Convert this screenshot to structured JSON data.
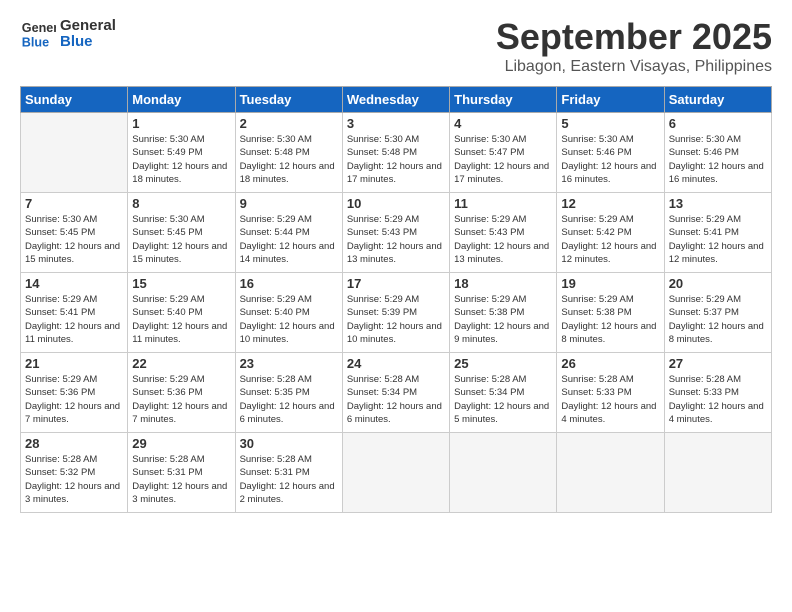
{
  "logo": {
    "line1": "General",
    "line2": "Blue"
  },
  "header": {
    "month": "September 2025",
    "location": "Libagon, Eastern Visayas, Philippines"
  },
  "days_of_week": [
    "Sunday",
    "Monday",
    "Tuesday",
    "Wednesday",
    "Thursday",
    "Friday",
    "Saturday"
  ],
  "weeks": [
    [
      {
        "day": "",
        "sunrise": "",
        "sunset": "",
        "daylight": "",
        "empty": true
      },
      {
        "day": "1",
        "sunrise": "Sunrise: 5:30 AM",
        "sunset": "Sunset: 5:49 PM",
        "daylight": "Daylight: 12 hours and 18 minutes."
      },
      {
        "day": "2",
        "sunrise": "Sunrise: 5:30 AM",
        "sunset": "Sunset: 5:48 PM",
        "daylight": "Daylight: 12 hours and 18 minutes."
      },
      {
        "day": "3",
        "sunrise": "Sunrise: 5:30 AM",
        "sunset": "Sunset: 5:48 PM",
        "daylight": "Daylight: 12 hours and 17 minutes."
      },
      {
        "day": "4",
        "sunrise": "Sunrise: 5:30 AM",
        "sunset": "Sunset: 5:47 PM",
        "daylight": "Daylight: 12 hours and 17 minutes."
      },
      {
        "day": "5",
        "sunrise": "Sunrise: 5:30 AM",
        "sunset": "Sunset: 5:46 PM",
        "daylight": "Daylight: 12 hours and 16 minutes."
      },
      {
        "day": "6",
        "sunrise": "Sunrise: 5:30 AM",
        "sunset": "Sunset: 5:46 PM",
        "daylight": "Daylight: 12 hours and 16 minutes."
      }
    ],
    [
      {
        "day": "7",
        "sunrise": "Sunrise: 5:30 AM",
        "sunset": "Sunset: 5:45 PM",
        "daylight": "Daylight: 12 hours and 15 minutes."
      },
      {
        "day": "8",
        "sunrise": "Sunrise: 5:30 AM",
        "sunset": "Sunset: 5:45 PM",
        "daylight": "Daylight: 12 hours and 15 minutes."
      },
      {
        "day": "9",
        "sunrise": "Sunrise: 5:29 AM",
        "sunset": "Sunset: 5:44 PM",
        "daylight": "Daylight: 12 hours and 14 minutes."
      },
      {
        "day": "10",
        "sunrise": "Sunrise: 5:29 AM",
        "sunset": "Sunset: 5:43 PM",
        "daylight": "Daylight: 12 hours and 13 minutes."
      },
      {
        "day": "11",
        "sunrise": "Sunrise: 5:29 AM",
        "sunset": "Sunset: 5:43 PM",
        "daylight": "Daylight: 12 hours and 13 minutes."
      },
      {
        "day": "12",
        "sunrise": "Sunrise: 5:29 AM",
        "sunset": "Sunset: 5:42 PM",
        "daylight": "Daylight: 12 hours and 12 minutes."
      },
      {
        "day": "13",
        "sunrise": "Sunrise: 5:29 AM",
        "sunset": "Sunset: 5:41 PM",
        "daylight": "Daylight: 12 hours and 12 minutes."
      }
    ],
    [
      {
        "day": "14",
        "sunrise": "Sunrise: 5:29 AM",
        "sunset": "Sunset: 5:41 PM",
        "daylight": "Daylight: 12 hours and 11 minutes."
      },
      {
        "day": "15",
        "sunrise": "Sunrise: 5:29 AM",
        "sunset": "Sunset: 5:40 PM",
        "daylight": "Daylight: 12 hours and 11 minutes."
      },
      {
        "day": "16",
        "sunrise": "Sunrise: 5:29 AM",
        "sunset": "Sunset: 5:40 PM",
        "daylight": "Daylight: 12 hours and 10 minutes."
      },
      {
        "day": "17",
        "sunrise": "Sunrise: 5:29 AM",
        "sunset": "Sunset: 5:39 PM",
        "daylight": "Daylight: 12 hours and 10 minutes."
      },
      {
        "day": "18",
        "sunrise": "Sunrise: 5:29 AM",
        "sunset": "Sunset: 5:38 PM",
        "daylight": "Daylight: 12 hours and 9 minutes."
      },
      {
        "day": "19",
        "sunrise": "Sunrise: 5:29 AM",
        "sunset": "Sunset: 5:38 PM",
        "daylight": "Daylight: 12 hours and 8 minutes."
      },
      {
        "day": "20",
        "sunrise": "Sunrise: 5:29 AM",
        "sunset": "Sunset: 5:37 PM",
        "daylight": "Daylight: 12 hours and 8 minutes."
      }
    ],
    [
      {
        "day": "21",
        "sunrise": "Sunrise: 5:29 AM",
        "sunset": "Sunset: 5:36 PM",
        "daylight": "Daylight: 12 hours and 7 minutes."
      },
      {
        "day": "22",
        "sunrise": "Sunrise: 5:29 AM",
        "sunset": "Sunset: 5:36 PM",
        "daylight": "Daylight: 12 hours and 7 minutes."
      },
      {
        "day": "23",
        "sunrise": "Sunrise: 5:28 AM",
        "sunset": "Sunset: 5:35 PM",
        "daylight": "Daylight: 12 hours and 6 minutes."
      },
      {
        "day": "24",
        "sunrise": "Sunrise: 5:28 AM",
        "sunset": "Sunset: 5:34 PM",
        "daylight": "Daylight: 12 hours and 6 minutes."
      },
      {
        "day": "25",
        "sunrise": "Sunrise: 5:28 AM",
        "sunset": "Sunset: 5:34 PM",
        "daylight": "Daylight: 12 hours and 5 minutes."
      },
      {
        "day": "26",
        "sunrise": "Sunrise: 5:28 AM",
        "sunset": "Sunset: 5:33 PM",
        "daylight": "Daylight: 12 hours and 4 minutes."
      },
      {
        "day": "27",
        "sunrise": "Sunrise: 5:28 AM",
        "sunset": "Sunset: 5:33 PM",
        "daylight": "Daylight: 12 hours and 4 minutes."
      }
    ],
    [
      {
        "day": "28",
        "sunrise": "Sunrise: 5:28 AM",
        "sunset": "Sunset: 5:32 PM",
        "daylight": "Daylight: 12 hours and 3 minutes."
      },
      {
        "day": "29",
        "sunrise": "Sunrise: 5:28 AM",
        "sunset": "Sunset: 5:31 PM",
        "daylight": "Daylight: 12 hours and 3 minutes."
      },
      {
        "day": "30",
        "sunrise": "Sunrise: 5:28 AM",
        "sunset": "Sunset: 5:31 PM",
        "daylight": "Daylight: 12 hours and 2 minutes."
      },
      {
        "day": "",
        "sunrise": "",
        "sunset": "",
        "daylight": "",
        "empty": true
      },
      {
        "day": "",
        "sunrise": "",
        "sunset": "",
        "daylight": "",
        "empty": true
      },
      {
        "day": "",
        "sunrise": "",
        "sunset": "",
        "daylight": "",
        "empty": true
      },
      {
        "day": "",
        "sunrise": "",
        "sunset": "",
        "daylight": "",
        "empty": true
      }
    ]
  ]
}
